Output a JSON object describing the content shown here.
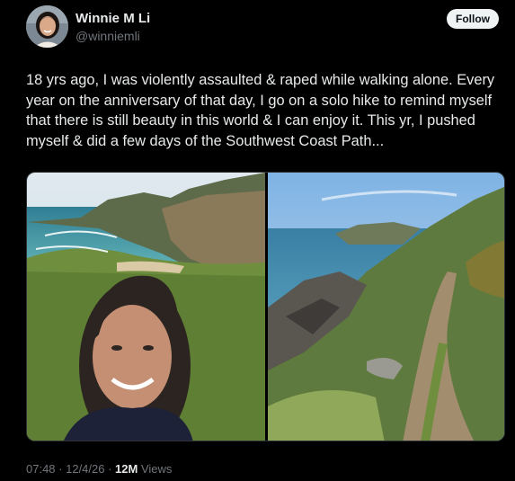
{
  "author": {
    "name": "Winnie M Li",
    "handle": "@winniemli"
  },
  "follow_button": {
    "label": "Follow"
  },
  "tweet": {
    "text": "18 yrs ago, I was violently assaulted & raped while walking alone. Every year on the anniversary of that day, I go on a solo hike to remind myself that there is still beauty in this world & I can enjoy it. This yr, I pushed myself & did a few days of the Southwest Coast Path..."
  },
  "media": {
    "photos": [
      {
        "icon": "selfie-coast-photo"
      },
      {
        "icon": "coastal-path-photo"
      }
    ]
  },
  "meta": {
    "time": "07:48",
    "separator1": " · ",
    "date": "12/4/26",
    "separator2": " · ",
    "views_count": "12M",
    "views_label": " Views"
  },
  "colors": {
    "background": "#000000",
    "text_primary": "#e7e9ea",
    "text_secondary": "#71767b",
    "follow_bg": "#eff3f4"
  }
}
